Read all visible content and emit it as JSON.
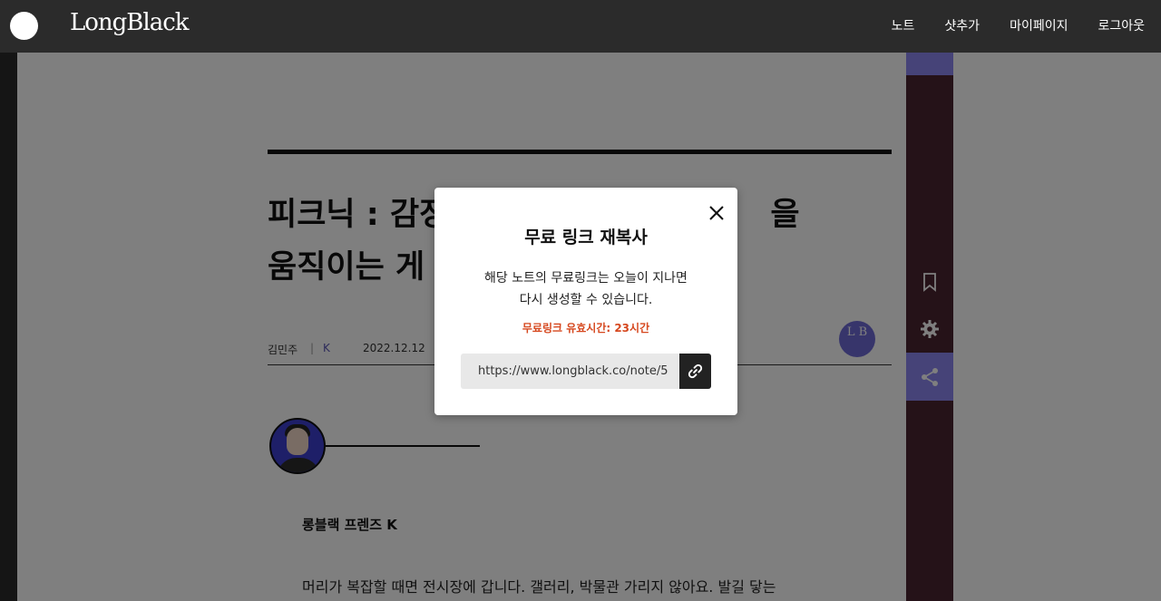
{
  "header": {
    "logo_text": "LongBlack",
    "nav": [
      "노트",
      "샷추가",
      "마이페이지",
      "로그아웃"
    ]
  },
  "article": {
    "title_line1": "피크닉 : 감정",
    "title_line1_tail": "을",
    "title_line2": "움직이는 게 ",
    "author": "김민주",
    "separator": "|",
    "category": "K",
    "date": "2022.12.12",
    "badge_text": "L B",
    "friend_label": "롱블랙 프렌즈 K",
    "body_first_line": "머리가 복잡할 때면 전시장에 갑니다. 갤러리, 박물관 가리지 않아요. 발길 닿는"
  },
  "modal": {
    "title": "무료 링크 재복사",
    "desc_line1": "해당 노트의 무료링크는 오늘이 지나면",
    "desc_line2": "다시 생성할 수 있습니다.",
    "warning": "무료링크 유효시간: 23시간",
    "link_value": "https://www.longblack.co/note/5",
    "close_icon": "close-icon",
    "copy_icon": "link-icon"
  },
  "colors": {
    "accent_purple": "#8d87f0",
    "rail": "#4a2530",
    "warning": "#d6481f"
  }
}
